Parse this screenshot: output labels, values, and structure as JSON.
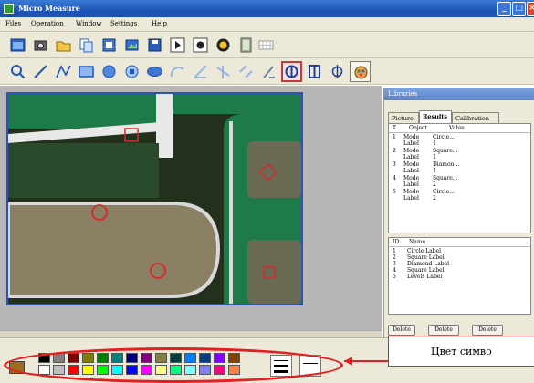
{
  "window": {
    "title": "Micro Measure"
  },
  "menu": {
    "items": [
      "Files",
      "Operation",
      "Window",
      "Settings",
      "Help"
    ]
  },
  "toolbar1": {
    "buttons": [
      "window-icon",
      "camera-icon",
      "folder-open-icon",
      "copy-icon",
      "export-icon",
      "capture-icon",
      "save-icon",
      "play-icon",
      "stop-icon",
      "record-icon",
      "film-icon",
      "grid-icon"
    ]
  },
  "toolbar2": {
    "buttons": [
      "select-pointer-icon",
      "line-icon",
      "polyline-icon",
      "rectangle-icon",
      "circle-icon",
      "circle-3point-icon",
      "ellipse-icon",
      "arc-icon",
      "angle-icon",
      "perpendicular-icon",
      "parallel-icon",
      "distance-icon",
      "circle-diameter-icon",
      "square-measure-icon",
      "diameter-icon",
      "color-settings-icon"
    ],
    "selected_index": 12
  },
  "panel": {
    "title": "Libraries",
    "tabs": [
      "Picture",
      "Results",
      "Calibration"
    ],
    "active_tab": 1,
    "results": {
      "headers": [
        "T",
        "Object",
        "Value"
      ],
      "rows": [
        {
          "num": "1",
          "lines": [
            [
              "Mode",
              "Circle..."
            ],
            [
              "Label",
              "1"
            ]
          ]
        },
        {
          "num": "2",
          "lines": [
            [
              "Mode",
              "Square..."
            ],
            [
              "Label",
              "1"
            ]
          ]
        },
        {
          "num": "3",
          "lines": [
            [
              "Mode",
              "Diamon..."
            ],
            [
              "Label",
              "1"
            ]
          ]
        },
        {
          "num": "4",
          "lines": [
            [
              "Mode",
              "Square..."
            ],
            [
              "Label",
              "2"
            ]
          ]
        },
        {
          "num": "5",
          "lines": [
            [
              "Mode",
              "Circle..."
            ],
            [
              "Label",
              "2"
            ]
          ]
        }
      ]
    },
    "labels": {
      "headers": [
        "ID",
        "Name"
      ],
      "rows": [
        [
          "1",
          "Circle Label"
        ],
        [
          "2",
          "Square Label"
        ],
        [
          "3",
          "Diamond Label"
        ],
        [
          "4",
          "Square Label"
        ],
        [
          "5",
          "Levels Label"
        ]
      ]
    },
    "buttons": [
      "Delete",
      "Delete",
      "Delete"
    ]
  },
  "palette": {
    "current_color": "#9e6a1c",
    "row1": [
      "#000000",
      "#808080",
      "#800000",
      "#808000",
      "#008000",
      "#008080",
      "#000080",
      "#800080",
      "#808040",
      "#004040",
      "#0080ff",
      "#004080",
      "#8000ff",
      "#804000"
    ],
    "row2": [
      "#ffffff",
      "#c0c0c0",
      "#ff0000",
      "#ffff00",
      "#00ff00",
      "#00ffff",
      "#0000ff",
      "#ff00ff",
      "#ffff80",
      "#00ff80",
      "#80ffff",
      "#8080ff",
      "#ff0080",
      "#ff8040"
    ]
  },
  "callout": {
    "text": "Цвет симво"
  },
  "overlays": {
    "marker_color": "#d62a2a",
    "frame_color": "#2f52b8"
  }
}
